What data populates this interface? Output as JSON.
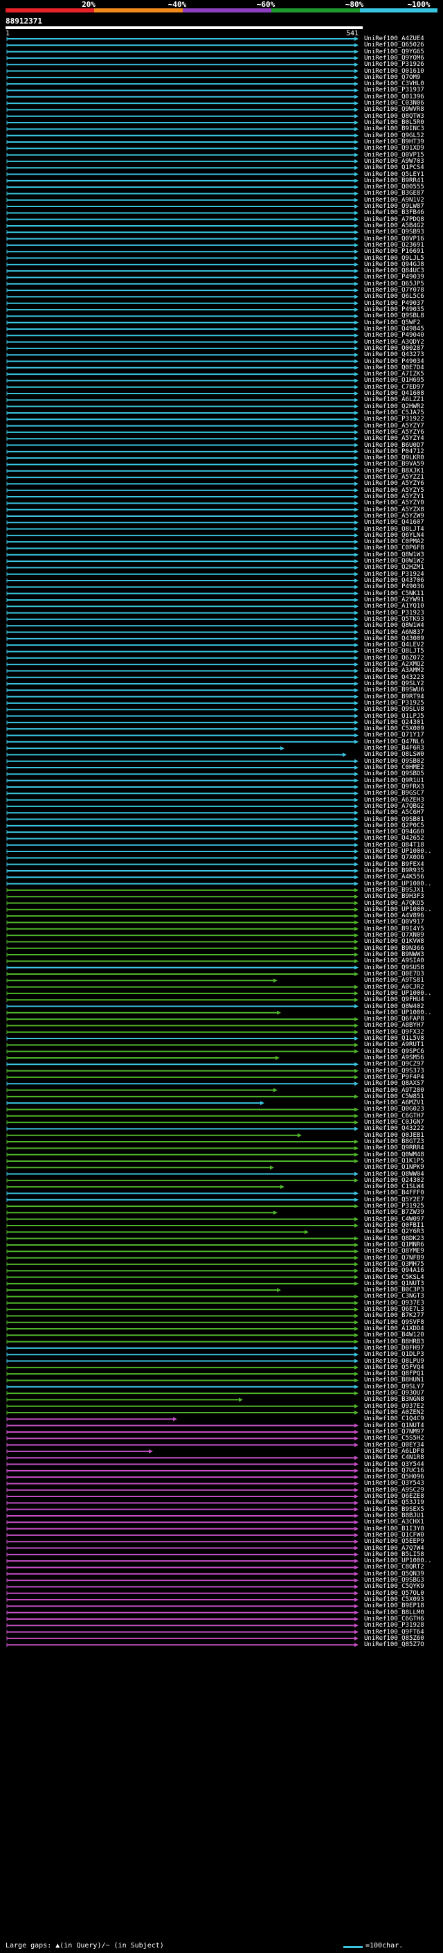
{
  "legend": {
    "labels": [
      "20%",
      "~40%",
      "~60%",
      "~80%",
      "~100%"
    ],
    "colors": [
      "#e8242a",
      "#f08a1c",
      "#8e3fbf",
      "#1e9a2e",
      "#39c5e0"
    ]
  },
  "query": {
    "id": "88912371",
    "ruler_start": "1",
    "ruler_end": "541"
  },
  "colors": {
    "cyan": "#39c5e0",
    "green": "#4fb52a",
    "magenta": "#c44fc4",
    "black_mark": "#000000",
    "white_mark": "#ffffff"
  },
  "hits": [
    {
      "label": "UniRef100_A4ZUE4",
      "color": "cyan"
    },
    {
      "label": "UniRef100_Q65026",
      "color": "cyan"
    },
    {
      "label": "UniRef100_Q9YG65",
      "color": "cyan"
    },
    {
      "label": "UniRef100_Q9YOM6",
      "color": "cyan"
    },
    {
      "label": "UniRef100_P31926",
      "color": "cyan"
    },
    {
      "label": "UniRef100_Q01610",
      "color": "cyan"
    },
    {
      "label": "UniRef100_Q7OM9",
      "color": "cyan"
    },
    {
      "label": "UniRef100_C3VHL0",
      "color": "cyan"
    },
    {
      "label": "UniRef100_P31937",
      "color": "cyan"
    },
    {
      "label": "UniRef100_Q01396",
      "color": "cyan"
    },
    {
      "label": "UniRef100_C03N06",
      "color": "cyan"
    },
    {
      "label": "UniRef100_Q9WVR8",
      "color": "cyan"
    },
    {
      "label": "UniRef100_Q8QTW3",
      "color": "cyan"
    },
    {
      "label": "UniRef100_B0L5R0",
      "color": "cyan"
    },
    {
      "label": "UniRef100_B9INC3",
      "color": "cyan"
    },
    {
      "label": "UniRef100_Q9GL52",
      "color": "cyan"
    },
    {
      "label": "UniRef100_B9HT39",
      "color": "cyan"
    },
    {
      "label": "UniRef100_Q91XD9",
      "color": "cyan"
    },
    {
      "label": "UniRef100_Q0VP15",
      "color": "cyan"
    },
    {
      "label": "UniRef100_A9W703",
      "color": "cyan"
    },
    {
      "label": "UniRef100_Q1PCS4",
      "color": "cyan"
    },
    {
      "label": "UniRef100_Q5LEY1",
      "color": "cyan"
    },
    {
      "label": "UniRef100_B9RR41",
      "color": "cyan"
    },
    {
      "label": "UniRef100_Q00555",
      "color": "cyan"
    },
    {
      "label": "UniRef100_B3GE87",
      "color": "cyan"
    },
    {
      "label": "UniRef100_A9N1V2",
      "color": "cyan"
    },
    {
      "label": "UniRef100_Q9LW87",
      "color": "cyan"
    },
    {
      "label": "UniRef100_B3FB46",
      "color": "cyan"
    },
    {
      "label": "UniRef100_A7PDQ8",
      "color": "cyan"
    },
    {
      "label": "UniRef100_A5B4G2",
      "color": "cyan"
    },
    {
      "label": "UniRef100_Q9SB93",
      "color": "cyan"
    },
    {
      "label": "UniRef100_Q0VP16",
      "color": "cyan"
    },
    {
      "label": "UniRef100_Q23691",
      "color": "cyan"
    },
    {
      "label": "UniRef100_P16691",
      "color": "cyan"
    },
    {
      "label": "UniRef100_Q9LJL5",
      "color": "cyan"
    },
    {
      "label": "UniRef100_Q94GJ8",
      "color": "cyan"
    },
    {
      "label": "UniRef100_Q84UC3",
      "color": "cyan"
    },
    {
      "label": "UniRef100_P49039",
      "color": "cyan"
    },
    {
      "label": "UniRef100_Q65JP5",
      "color": "cyan"
    },
    {
      "label": "UniRef100_Q7Y078",
      "color": "cyan"
    },
    {
      "label": "UniRef100_Q6L5C6",
      "color": "cyan"
    },
    {
      "label": "UniRef100_P49037",
      "color": "cyan"
    },
    {
      "label": "UniRef100_P49035",
      "color": "cyan"
    },
    {
      "label": "UniRef100_Q9SBL8",
      "color": "cyan"
    },
    {
      "label": "UniRef100_Q5WF2",
      "color": "cyan"
    },
    {
      "label": "UniRef100_Q49845",
      "color": "cyan"
    },
    {
      "label": "UniRef100_P49040",
      "color": "cyan"
    },
    {
      "label": "UniRef100_A3QDY2",
      "color": "cyan"
    },
    {
      "label": "UniRef100_Q00287",
      "color": "cyan"
    },
    {
      "label": "UniRef100_Q43273",
      "color": "cyan"
    },
    {
      "label": "UniRef100_P49034",
      "color": "cyan"
    },
    {
      "label": "UniRef100_Q0E7D4",
      "color": "cyan"
    },
    {
      "label": "UniRef100_A7IZK5",
      "color": "cyan"
    },
    {
      "label": "UniRef100_Q1H695",
      "color": "cyan"
    },
    {
      "label": "UniRef100_C7ED97",
      "color": "cyan"
    },
    {
      "label": "UniRef100_Q41608",
      "color": "cyan"
    },
    {
      "label": "UniRef100_A6LZZ1",
      "color": "cyan"
    },
    {
      "label": "UniRef100_Q2HWR2",
      "color": "cyan"
    },
    {
      "label": "UniRef100_C5JA75",
      "color": "cyan"
    },
    {
      "label": "UniRef100_P31922",
      "color": "cyan"
    },
    {
      "label": "UniRef100_A5YZY7",
      "color": "cyan"
    },
    {
      "label": "UniRef100_A5YZY6",
      "color": "cyan"
    },
    {
      "label": "UniRef100_A5YZY4",
      "color": "cyan"
    },
    {
      "label": "UniRef100_B6U0D7",
      "color": "cyan"
    },
    {
      "label": "UniRef100_P04712",
      "color": "cyan"
    },
    {
      "label": "UniRef100_Q9LKR0",
      "color": "cyan"
    },
    {
      "label": "UniRef100_B9VA59",
      "color": "cyan"
    },
    {
      "label": "UniRef100_B8XJK1",
      "color": "cyan"
    },
    {
      "label": "UniRef100_A5YZZ1",
      "color": "cyan"
    },
    {
      "label": "UniRef100_A5YZY6",
      "color": "cyan"
    },
    {
      "label": "UniRef100_A5YZY5",
      "color": "cyan"
    },
    {
      "label": "UniRef100_A5YZY1",
      "color": "cyan"
    },
    {
      "label": "UniRef100_A5YZY0",
      "color": "cyan"
    },
    {
      "label": "UniRef100_A5YZX8",
      "color": "cyan"
    },
    {
      "label": "UniRef100_A5YZW9",
      "color": "cyan"
    },
    {
      "label": "UniRef100_Q41607",
      "color": "cyan"
    },
    {
      "label": "UniRef100_Q8LJT4",
      "color": "cyan"
    },
    {
      "label": "UniRef100_Q6YLN4",
      "color": "cyan"
    },
    {
      "label": "UniRef100_C0PMA2",
      "color": "cyan"
    },
    {
      "label": "UniRef100_C0P6F8",
      "color": "cyan"
    },
    {
      "label": "UniRef100_Q8W1W3",
      "color": "cyan"
    },
    {
      "label": "UniRef100_Q0W1W2",
      "color": "cyan"
    },
    {
      "label": "UniRef100_Q2HZM1",
      "color": "cyan"
    },
    {
      "label": "UniRef100_P31924",
      "color": "cyan"
    },
    {
      "label": "UniRef100_Q43706",
      "color": "cyan"
    },
    {
      "label": "UniRef100_P49036",
      "color": "cyan"
    },
    {
      "label": "UniRef100_C5NK11",
      "color": "cyan"
    },
    {
      "label": "UniRef100_A2YW91",
      "color": "cyan"
    },
    {
      "label": "UniRef100_A1YQ10",
      "color": "cyan"
    },
    {
      "label": "UniRef100_P31923",
      "color": "cyan"
    },
    {
      "label": "UniRef100_Q5TK93",
      "color": "cyan"
    },
    {
      "label": "UniRef100_Q8W1W4",
      "color": "cyan"
    },
    {
      "label": "UniRef100_A6N837",
      "color": "cyan"
    },
    {
      "label": "UniRef100_Q43009",
      "color": "cyan"
    },
    {
      "label": "UniRef100_Q4LEV2",
      "color": "cyan"
    },
    {
      "label": "UniRef100_Q8LJT5",
      "color": "cyan"
    },
    {
      "label": "UniRef100_Q6Z072",
      "color": "cyan"
    },
    {
      "label": "UniRef100_A2XMQ2",
      "color": "cyan"
    },
    {
      "label": "UniRef100_A3AMM2",
      "color": "cyan"
    },
    {
      "label": "UniRef100_Q43223",
      "color": "cyan"
    },
    {
      "label": "UniRef100_Q9SLY2",
      "color": "cyan"
    },
    {
      "label": "UniRef100_B9SWU6",
      "color": "cyan"
    },
    {
      "label": "UniRef100_B9RT94",
      "color": "cyan"
    },
    {
      "label": "UniRef100_P31925",
      "color": "cyan"
    },
    {
      "label": "UniRef100_Q9SLV8",
      "color": "cyan"
    },
    {
      "label": "UniRef100_Q1LPJ5",
      "color": "cyan"
    },
    {
      "label": "UniRef100_Q24301",
      "color": "cyan"
    },
    {
      "label": "UniRef100_C5X009",
      "color": "cyan"
    },
    {
      "label": "UniRef100_Q71Y17",
      "color": "cyan"
    },
    {
      "label": "UniRef100_Q47NL6",
      "color": "cyan"
    },
    {
      "label": "UniRef100_B4F6R3",
      "color": "cyan"
    },
    {
      "label": "UniRef100_Q8LSW0",
      "color": "cyan"
    },
    {
      "label": "UniRef100_Q9SB02",
      "color": "cyan"
    },
    {
      "label": "UniRef100_C0HME2",
      "color": "cyan"
    },
    {
      "label": "UniRef100_Q9SBD5",
      "color": "cyan"
    },
    {
      "label": "UniRef100_Q9R1U1",
      "color": "cyan"
    },
    {
      "label": "UniRef100_Q9FRX3",
      "color": "cyan"
    },
    {
      "label": "UniRef100_B9GSC7",
      "color": "cyan"
    },
    {
      "label": "UniRef100_A6ZEH3",
      "color": "cyan"
    },
    {
      "label": "UniRef100_A7QBG2",
      "color": "cyan"
    },
    {
      "label": "UniRef100_A5C6H7",
      "color": "cyan"
    },
    {
      "label": "UniRef100_Q9SB01",
      "color": "cyan"
    },
    {
      "label": "UniRef100_Q2P0C5",
      "color": "cyan"
    },
    {
      "label": "UniRef100_Q94G60",
      "color": "cyan"
    },
    {
      "label": "UniRef100_Q42652",
      "color": "cyan"
    },
    {
      "label": "UniRef100_Q84T18",
      "color": "cyan"
    },
    {
      "label": "UniRef100_UP1000..",
      "color": "cyan"
    },
    {
      "label": "UniRef100_Q7X0O6",
      "color": "cyan"
    },
    {
      "label": "UniRef100_B9FEX4",
      "color": "cyan"
    },
    {
      "label": "UniRef100_B9R935",
      "color": "cyan"
    },
    {
      "label": "UniRef100_A4K556",
      "color": "cyan"
    },
    {
      "label": "UniRef100_UP1000..",
      "color": "cyan"
    },
    {
      "label": "UniRef100_B9SJX1",
      "color": "green"
    },
    {
      "label": "UniRef100_B9H3F3",
      "color": "green"
    },
    {
      "label": "UniRef100_A7QKO5",
      "color": "green"
    },
    {
      "label": "UniRef100_UP1000..",
      "color": "green"
    },
    {
      "label": "UniRef100_A4V896",
      "color": "green"
    },
    {
      "label": "UniRef100_Q0V917",
      "color": "green"
    },
    {
      "label": "UniRef100_B9I4Y5",
      "color": "green"
    },
    {
      "label": "UniRef100_Q7XN09",
      "color": "green"
    },
    {
      "label": "UniRef100_Q1KVW8",
      "color": "green"
    },
    {
      "label": "UniRef100_B9N366",
      "color": "green"
    },
    {
      "label": "UniRef100_B9NWW3",
      "color": "green"
    },
    {
      "label": "UniRef100_A9SIA0",
      "color": "green"
    },
    {
      "label": "UniRef100_Q9SU58",
      "color": "cyan"
    },
    {
      "label": "UniRef100_Q0E7D3",
      "color": "green"
    },
    {
      "label": "UniRef100_A9TS81",
      "color": "green"
    },
    {
      "label": "UniRef100_A0CJR2",
      "color": "green"
    },
    {
      "label": "UniRef100_UP1000..",
      "color": "green"
    },
    {
      "label": "UniRef100_Q9FHU4",
      "color": "green"
    },
    {
      "label": "UniRef100_Q8W402",
      "color": "cyan"
    },
    {
      "label": "UniRef100_UP1000..",
      "color": "green"
    },
    {
      "label": "UniRef100_Q6FAP8",
      "color": "green"
    },
    {
      "label": "UniRef100_A8BYH7",
      "color": "green"
    },
    {
      "label": "UniRef100_Q9FX32",
      "color": "green"
    },
    {
      "label": "UniRef100_Q1L5V8",
      "color": "cyan"
    },
    {
      "label": "UniRef100_A9RUT1",
      "color": "green"
    },
    {
      "label": "UniRef100_Q9SPC6",
      "color": "green"
    },
    {
      "label": "UniRef100_A9SM56",
      "color": "green"
    },
    {
      "label": "UniRef100_Q9CZ97",
      "color": "cyan"
    },
    {
      "label": "UniRef100_Q9S373",
      "color": "green"
    },
    {
      "label": "UniRef100_P9F4P4",
      "color": "green"
    },
    {
      "label": "UniRef100_Q8AXS7",
      "color": "cyan"
    },
    {
      "label": "UniRef100_A9T280",
      "color": "green"
    },
    {
      "label": "UniRef100_C5W851",
      "color": "green"
    },
    {
      "label": "UniRef100_A6MZV1",
      "color": "cyan"
    },
    {
      "label": "UniRef100_Q0G023",
      "color": "green"
    },
    {
      "label": "UniRef100_C6GTH7",
      "color": "green"
    },
    {
      "label": "UniRef100_C0JGN7",
      "color": "green"
    },
    {
      "label": "UniRef100_Q43222",
      "color": "cyan"
    },
    {
      "label": "UniRef100_Q0JEB1",
      "color": "green"
    },
    {
      "label": "UniRef100_B8GTZ3",
      "color": "green"
    },
    {
      "label": "UniRef100_Q9RRR4",
      "color": "green"
    },
    {
      "label": "UniRef100_Q0WM48",
      "color": "green"
    },
    {
      "label": "UniRef100_Q1K1P5",
      "color": "green"
    },
    {
      "label": "UniRef100_Q1NPK9",
      "color": "green"
    },
    {
      "label": "UniRef100_Q8WW04",
      "color": "cyan"
    },
    {
      "label": "UniRef100_Q24302",
      "color": "green"
    },
    {
      "label": "UniRef100_C1SLW4",
      "color": "green"
    },
    {
      "label": "UniRef100_B4FFF0",
      "color": "cyan"
    },
    {
      "label": "UniRef100_Q5Y2E7",
      "color": "cyan"
    },
    {
      "label": "UniRef100_P31925",
      "color": "green"
    },
    {
      "label": "UniRef100_B7ZW39",
      "color": "green"
    },
    {
      "label": "UniRef100_C4W097",
      "color": "green"
    },
    {
      "label": "UniRef100_Q0FBI1",
      "color": "green"
    },
    {
      "label": "UniRef100_Q2Y6R3",
      "color": "green"
    },
    {
      "label": "UniRef100_Q8DK23",
      "color": "green"
    },
    {
      "label": "UniRef100_Q1MNR6",
      "color": "green"
    },
    {
      "label": "UniRef100_Q8YME9",
      "color": "green"
    },
    {
      "label": "UniRef100_Q7NFB9",
      "color": "green"
    },
    {
      "label": "UniRef100_Q3MH75",
      "color": "green"
    },
    {
      "label": "UniRef100_Q94A16",
      "color": "green"
    },
    {
      "label": "UniRef100_C5KSL4",
      "color": "green"
    },
    {
      "label": "UniRef100_Q1NUT3",
      "color": "green"
    },
    {
      "label": "UniRef100_B0C3P3",
      "color": "green"
    },
    {
      "label": "UniRef100_C3NGT3",
      "color": "green"
    },
    {
      "label": "UniRef100_Q937E3",
      "color": "green"
    },
    {
      "label": "UniRef100_Q6E7L3",
      "color": "green"
    },
    {
      "label": "UniRef100_B7K277",
      "color": "green"
    },
    {
      "label": "UniRef100_Q9SVF8",
      "color": "green"
    },
    {
      "label": "UniRef100_A1XDD4",
      "color": "green"
    },
    {
      "label": "UniRef100_B4W120",
      "color": "green"
    },
    {
      "label": "UniRef100_B8HRB3",
      "color": "green"
    },
    {
      "label": "UniRef100_D0FH97",
      "color": "cyan"
    },
    {
      "label": "UniRef100_Q1DLP3",
      "color": "cyan"
    },
    {
      "label": "UniRef100_Q8LPU9",
      "color": "cyan"
    },
    {
      "label": "UniRef100_Q5FVQ4",
      "color": "green"
    },
    {
      "label": "UniRef100_Q8FPQ1",
      "color": "green"
    },
    {
      "label": "UniRef100_B8HUN1",
      "color": "green"
    },
    {
      "label": "UniRef100_Q9SLY7",
      "color": "cyan"
    },
    {
      "label": "UniRef100_Q93OU7",
      "color": "green"
    },
    {
      "label": "UniRef100_B3NGN8",
      "color": "green"
    },
    {
      "label": "UniRef100_Q937E2",
      "color": "green"
    },
    {
      "label": "UniRef100_A0ZEN2",
      "color": "green"
    },
    {
      "label": "UniRef100_C1Q4C9",
      "color": "magenta"
    },
    {
      "label": "UniRef100_Q1NUT4",
      "color": "magenta"
    },
    {
      "label": "UniRef100_Q7NM97",
      "color": "magenta"
    },
    {
      "label": "UniRef100_C5S5H2",
      "color": "magenta"
    },
    {
      "label": "UniRef100_Q0EY34",
      "color": "magenta"
    },
    {
      "label": "UniRef100_A6LDF8",
      "color": "magenta"
    },
    {
      "label": "UniRef100_C4N1R8",
      "color": "magenta"
    },
    {
      "label": "UniRef100_Q3Y544",
      "color": "magenta"
    },
    {
      "label": "UniRef100_Q7UC16",
      "color": "magenta"
    },
    {
      "label": "UniRef100_Q5H096",
      "color": "magenta"
    },
    {
      "label": "UniRef100_Q3Y543",
      "color": "magenta"
    },
    {
      "label": "UniRef100_A9SC29",
      "color": "magenta"
    },
    {
      "label": "UniRef100_Q6EZE8",
      "color": "magenta"
    },
    {
      "label": "UniRef100_Q53J19",
      "color": "magenta"
    },
    {
      "label": "UniRef100_B9SEX5",
      "color": "magenta"
    },
    {
      "label": "UniRef100_B8BJU1",
      "color": "magenta"
    },
    {
      "label": "UniRef100_A3CHX1",
      "color": "magenta"
    },
    {
      "label": "UniRef100_B1I3Y0",
      "color": "magenta"
    },
    {
      "label": "UniRef100_Q1CFW0",
      "color": "magenta"
    },
    {
      "label": "UniRef100_Q5EEP9",
      "color": "magenta"
    },
    {
      "label": "UniRef100_A7Q7W4",
      "color": "magenta"
    },
    {
      "label": "UniRef100_B5LI58",
      "color": "magenta"
    },
    {
      "label": "UniRef100_UP1000..",
      "color": "magenta"
    },
    {
      "label": "UniRef100_C8QRT2",
      "color": "magenta"
    },
    {
      "label": "UniRef100_Q5QN39",
      "color": "magenta"
    },
    {
      "label": "UniRef100_Q9SBG3",
      "color": "magenta"
    },
    {
      "label": "UniRef100_C5QYK9",
      "color": "magenta"
    },
    {
      "label": "UniRef100_Q57OL0",
      "color": "magenta"
    },
    {
      "label": "UniRef100_C5X093",
      "color": "magenta"
    },
    {
      "label": "UniRef100_B9EP18",
      "color": "magenta"
    },
    {
      "label": "UniRef100_B8LLM0",
      "color": "magenta"
    },
    {
      "label": "UniRef100_C6GTH6",
      "color": "magenta"
    },
    {
      "label": "UniRef100_P31928",
      "color": "magenta"
    },
    {
      "label": "UniRef100_Q9FT64",
      "color": "magenta"
    },
    {
      "label": "UniRef100_Q85Z60",
      "color": "magenta"
    },
    {
      "label": "UniRef100_Q85Z7O",
      "color": "magenta"
    }
  ],
  "footer": {
    "gap_text": "Large gaps: ▲(in Query)/~ (in Subject)",
    "scale_text": "=100char."
  }
}
